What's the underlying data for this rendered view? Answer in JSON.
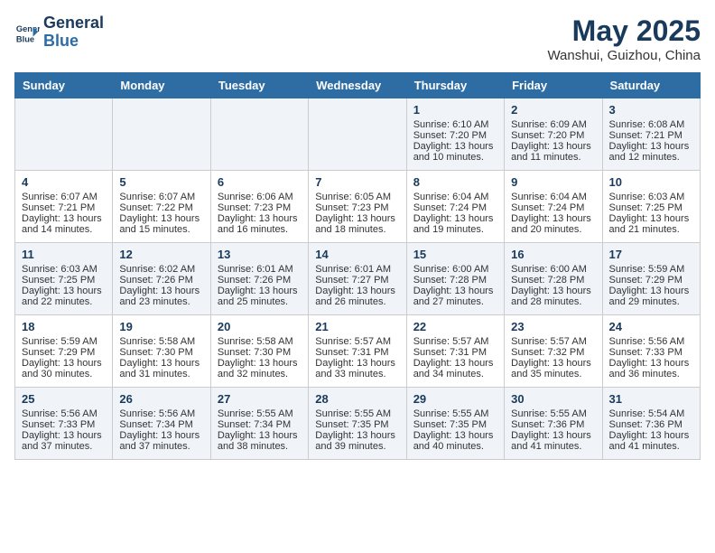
{
  "header": {
    "logo_line1": "General",
    "logo_line2": "Blue",
    "month_year": "May 2025",
    "location": "Wanshui, Guizhou, China"
  },
  "weekdays": [
    "Sunday",
    "Monday",
    "Tuesday",
    "Wednesday",
    "Thursday",
    "Friday",
    "Saturday"
  ],
  "weeks": [
    [
      {
        "day": "",
        "info": ""
      },
      {
        "day": "",
        "info": ""
      },
      {
        "day": "",
        "info": ""
      },
      {
        "day": "",
        "info": ""
      },
      {
        "day": "1",
        "info": "Sunrise: 6:10 AM\nSunset: 7:20 PM\nDaylight: 13 hours\nand 10 minutes."
      },
      {
        "day": "2",
        "info": "Sunrise: 6:09 AM\nSunset: 7:20 PM\nDaylight: 13 hours\nand 11 minutes."
      },
      {
        "day": "3",
        "info": "Sunrise: 6:08 AM\nSunset: 7:21 PM\nDaylight: 13 hours\nand 12 minutes."
      }
    ],
    [
      {
        "day": "4",
        "info": "Sunrise: 6:07 AM\nSunset: 7:21 PM\nDaylight: 13 hours\nand 14 minutes."
      },
      {
        "day": "5",
        "info": "Sunrise: 6:07 AM\nSunset: 7:22 PM\nDaylight: 13 hours\nand 15 minutes."
      },
      {
        "day": "6",
        "info": "Sunrise: 6:06 AM\nSunset: 7:23 PM\nDaylight: 13 hours\nand 16 minutes."
      },
      {
        "day": "7",
        "info": "Sunrise: 6:05 AM\nSunset: 7:23 PM\nDaylight: 13 hours\nand 18 minutes."
      },
      {
        "day": "8",
        "info": "Sunrise: 6:04 AM\nSunset: 7:24 PM\nDaylight: 13 hours\nand 19 minutes."
      },
      {
        "day": "9",
        "info": "Sunrise: 6:04 AM\nSunset: 7:24 PM\nDaylight: 13 hours\nand 20 minutes."
      },
      {
        "day": "10",
        "info": "Sunrise: 6:03 AM\nSunset: 7:25 PM\nDaylight: 13 hours\nand 21 minutes."
      }
    ],
    [
      {
        "day": "11",
        "info": "Sunrise: 6:03 AM\nSunset: 7:25 PM\nDaylight: 13 hours\nand 22 minutes."
      },
      {
        "day": "12",
        "info": "Sunrise: 6:02 AM\nSunset: 7:26 PM\nDaylight: 13 hours\nand 23 minutes."
      },
      {
        "day": "13",
        "info": "Sunrise: 6:01 AM\nSunset: 7:26 PM\nDaylight: 13 hours\nand 25 minutes."
      },
      {
        "day": "14",
        "info": "Sunrise: 6:01 AM\nSunset: 7:27 PM\nDaylight: 13 hours\nand 26 minutes."
      },
      {
        "day": "15",
        "info": "Sunrise: 6:00 AM\nSunset: 7:28 PM\nDaylight: 13 hours\nand 27 minutes."
      },
      {
        "day": "16",
        "info": "Sunrise: 6:00 AM\nSunset: 7:28 PM\nDaylight: 13 hours\nand 28 minutes."
      },
      {
        "day": "17",
        "info": "Sunrise: 5:59 AM\nSunset: 7:29 PM\nDaylight: 13 hours\nand 29 minutes."
      }
    ],
    [
      {
        "day": "18",
        "info": "Sunrise: 5:59 AM\nSunset: 7:29 PM\nDaylight: 13 hours\nand 30 minutes."
      },
      {
        "day": "19",
        "info": "Sunrise: 5:58 AM\nSunset: 7:30 PM\nDaylight: 13 hours\nand 31 minutes."
      },
      {
        "day": "20",
        "info": "Sunrise: 5:58 AM\nSunset: 7:30 PM\nDaylight: 13 hours\nand 32 minutes."
      },
      {
        "day": "21",
        "info": "Sunrise: 5:57 AM\nSunset: 7:31 PM\nDaylight: 13 hours\nand 33 minutes."
      },
      {
        "day": "22",
        "info": "Sunrise: 5:57 AM\nSunset: 7:31 PM\nDaylight: 13 hours\nand 34 minutes."
      },
      {
        "day": "23",
        "info": "Sunrise: 5:57 AM\nSunset: 7:32 PM\nDaylight: 13 hours\nand 35 minutes."
      },
      {
        "day": "24",
        "info": "Sunrise: 5:56 AM\nSunset: 7:33 PM\nDaylight: 13 hours\nand 36 minutes."
      }
    ],
    [
      {
        "day": "25",
        "info": "Sunrise: 5:56 AM\nSunset: 7:33 PM\nDaylight: 13 hours\nand 37 minutes."
      },
      {
        "day": "26",
        "info": "Sunrise: 5:56 AM\nSunset: 7:34 PM\nDaylight: 13 hours\nand 37 minutes."
      },
      {
        "day": "27",
        "info": "Sunrise: 5:55 AM\nSunset: 7:34 PM\nDaylight: 13 hours\nand 38 minutes."
      },
      {
        "day": "28",
        "info": "Sunrise: 5:55 AM\nSunset: 7:35 PM\nDaylight: 13 hours\nand 39 minutes."
      },
      {
        "day": "29",
        "info": "Sunrise: 5:55 AM\nSunset: 7:35 PM\nDaylight: 13 hours\nand 40 minutes."
      },
      {
        "day": "30",
        "info": "Sunrise: 5:55 AM\nSunset: 7:36 PM\nDaylight: 13 hours\nand 41 minutes."
      },
      {
        "day": "31",
        "info": "Sunrise: 5:54 AM\nSunset: 7:36 PM\nDaylight: 13 hours\nand 41 minutes."
      }
    ]
  ]
}
